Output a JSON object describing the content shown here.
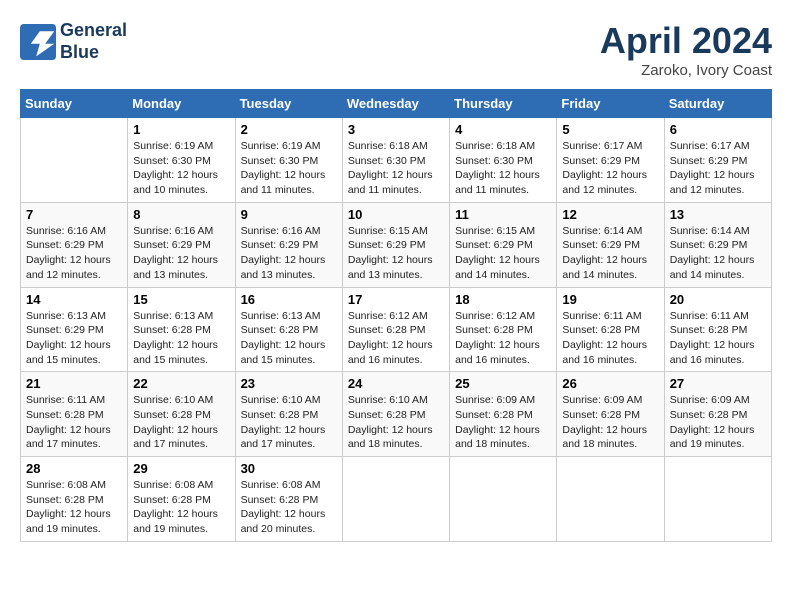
{
  "header": {
    "logo_line1": "General",
    "logo_line2": "Blue",
    "month": "April 2024",
    "location": "Zaroko, Ivory Coast"
  },
  "days_of_week": [
    "Sunday",
    "Monday",
    "Tuesday",
    "Wednesday",
    "Thursday",
    "Friday",
    "Saturday"
  ],
  "weeks": [
    [
      {
        "day": "",
        "info": ""
      },
      {
        "day": "1",
        "info": "Sunrise: 6:19 AM\nSunset: 6:30 PM\nDaylight: 12 hours\nand 10 minutes."
      },
      {
        "day": "2",
        "info": "Sunrise: 6:19 AM\nSunset: 6:30 PM\nDaylight: 12 hours\nand 11 minutes."
      },
      {
        "day": "3",
        "info": "Sunrise: 6:18 AM\nSunset: 6:30 PM\nDaylight: 12 hours\nand 11 minutes."
      },
      {
        "day": "4",
        "info": "Sunrise: 6:18 AM\nSunset: 6:30 PM\nDaylight: 12 hours\nand 11 minutes."
      },
      {
        "day": "5",
        "info": "Sunrise: 6:17 AM\nSunset: 6:29 PM\nDaylight: 12 hours\nand 12 minutes."
      },
      {
        "day": "6",
        "info": "Sunrise: 6:17 AM\nSunset: 6:29 PM\nDaylight: 12 hours\nand 12 minutes."
      }
    ],
    [
      {
        "day": "7",
        "info": "Sunrise: 6:16 AM\nSunset: 6:29 PM\nDaylight: 12 hours\nand 12 minutes."
      },
      {
        "day": "8",
        "info": "Sunrise: 6:16 AM\nSunset: 6:29 PM\nDaylight: 12 hours\nand 13 minutes."
      },
      {
        "day": "9",
        "info": "Sunrise: 6:16 AM\nSunset: 6:29 PM\nDaylight: 12 hours\nand 13 minutes."
      },
      {
        "day": "10",
        "info": "Sunrise: 6:15 AM\nSunset: 6:29 PM\nDaylight: 12 hours\nand 13 minutes."
      },
      {
        "day": "11",
        "info": "Sunrise: 6:15 AM\nSunset: 6:29 PM\nDaylight: 12 hours\nand 14 minutes."
      },
      {
        "day": "12",
        "info": "Sunrise: 6:14 AM\nSunset: 6:29 PM\nDaylight: 12 hours\nand 14 minutes."
      },
      {
        "day": "13",
        "info": "Sunrise: 6:14 AM\nSunset: 6:29 PM\nDaylight: 12 hours\nand 14 minutes."
      }
    ],
    [
      {
        "day": "14",
        "info": "Sunrise: 6:13 AM\nSunset: 6:29 PM\nDaylight: 12 hours\nand 15 minutes."
      },
      {
        "day": "15",
        "info": "Sunrise: 6:13 AM\nSunset: 6:28 PM\nDaylight: 12 hours\nand 15 minutes."
      },
      {
        "day": "16",
        "info": "Sunrise: 6:13 AM\nSunset: 6:28 PM\nDaylight: 12 hours\nand 15 minutes."
      },
      {
        "day": "17",
        "info": "Sunrise: 6:12 AM\nSunset: 6:28 PM\nDaylight: 12 hours\nand 16 minutes."
      },
      {
        "day": "18",
        "info": "Sunrise: 6:12 AM\nSunset: 6:28 PM\nDaylight: 12 hours\nand 16 minutes."
      },
      {
        "day": "19",
        "info": "Sunrise: 6:11 AM\nSunset: 6:28 PM\nDaylight: 12 hours\nand 16 minutes."
      },
      {
        "day": "20",
        "info": "Sunrise: 6:11 AM\nSunset: 6:28 PM\nDaylight: 12 hours\nand 16 minutes."
      }
    ],
    [
      {
        "day": "21",
        "info": "Sunrise: 6:11 AM\nSunset: 6:28 PM\nDaylight: 12 hours\nand 17 minutes."
      },
      {
        "day": "22",
        "info": "Sunrise: 6:10 AM\nSunset: 6:28 PM\nDaylight: 12 hours\nand 17 minutes."
      },
      {
        "day": "23",
        "info": "Sunrise: 6:10 AM\nSunset: 6:28 PM\nDaylight: 12 hours\nand 17 minutes."
      },
      {
        "day": "24",
        "info": "Sunrise: 6:10 AM\nSunset: 6:28 PM\nDaylight: 12 hours\nand 18 minutes."
      },
      {
        "day": "25",
        "info": "Sunrise: 6:09 AM\nSunset: 6:28 PM\nDaylight: 12 hours\nand 18 minutes."
      },
      {
        "day": "26",
        "info": "Sunrise: 6:09 AM\nSunset: 6:28 PM\nDaylight: 12 hours\nand 18 minutes."
      },
      {
        "day": "27",
        "info": "Sunrise: 6:09 AM\nSunset: 6:28 PM\nDaylight: 12 hours\nand 19 minutes."
      }
    ],
    [
      {
        "day": "28",
        "info": "Sunrise: 6:08 AM\nSunset: 6:28 PM\nDaylight: 12 hours\nand 19 minutes."
      },
      {
        "day": "29",
        "info": "Sunrise: 6:08 AM\nSunset: 6:28 PM\nDaylight: 12 hours\nand 19 minutes."
      },
      {
        "day": "30",
        "info": "Sunrise: 6:08 AM\nSunset: 6:28 PM\nDaylight: 12 hours\nand 20 minutes."
      },
      {
        "day": "",
        "info": ""
      },
      {
        "day": "",
        "info": ""
      },
      {
        "day": "",
        "info": ""
      },
      {
        "day": "",
        "info": ""
      }
    ]
  ]
}
